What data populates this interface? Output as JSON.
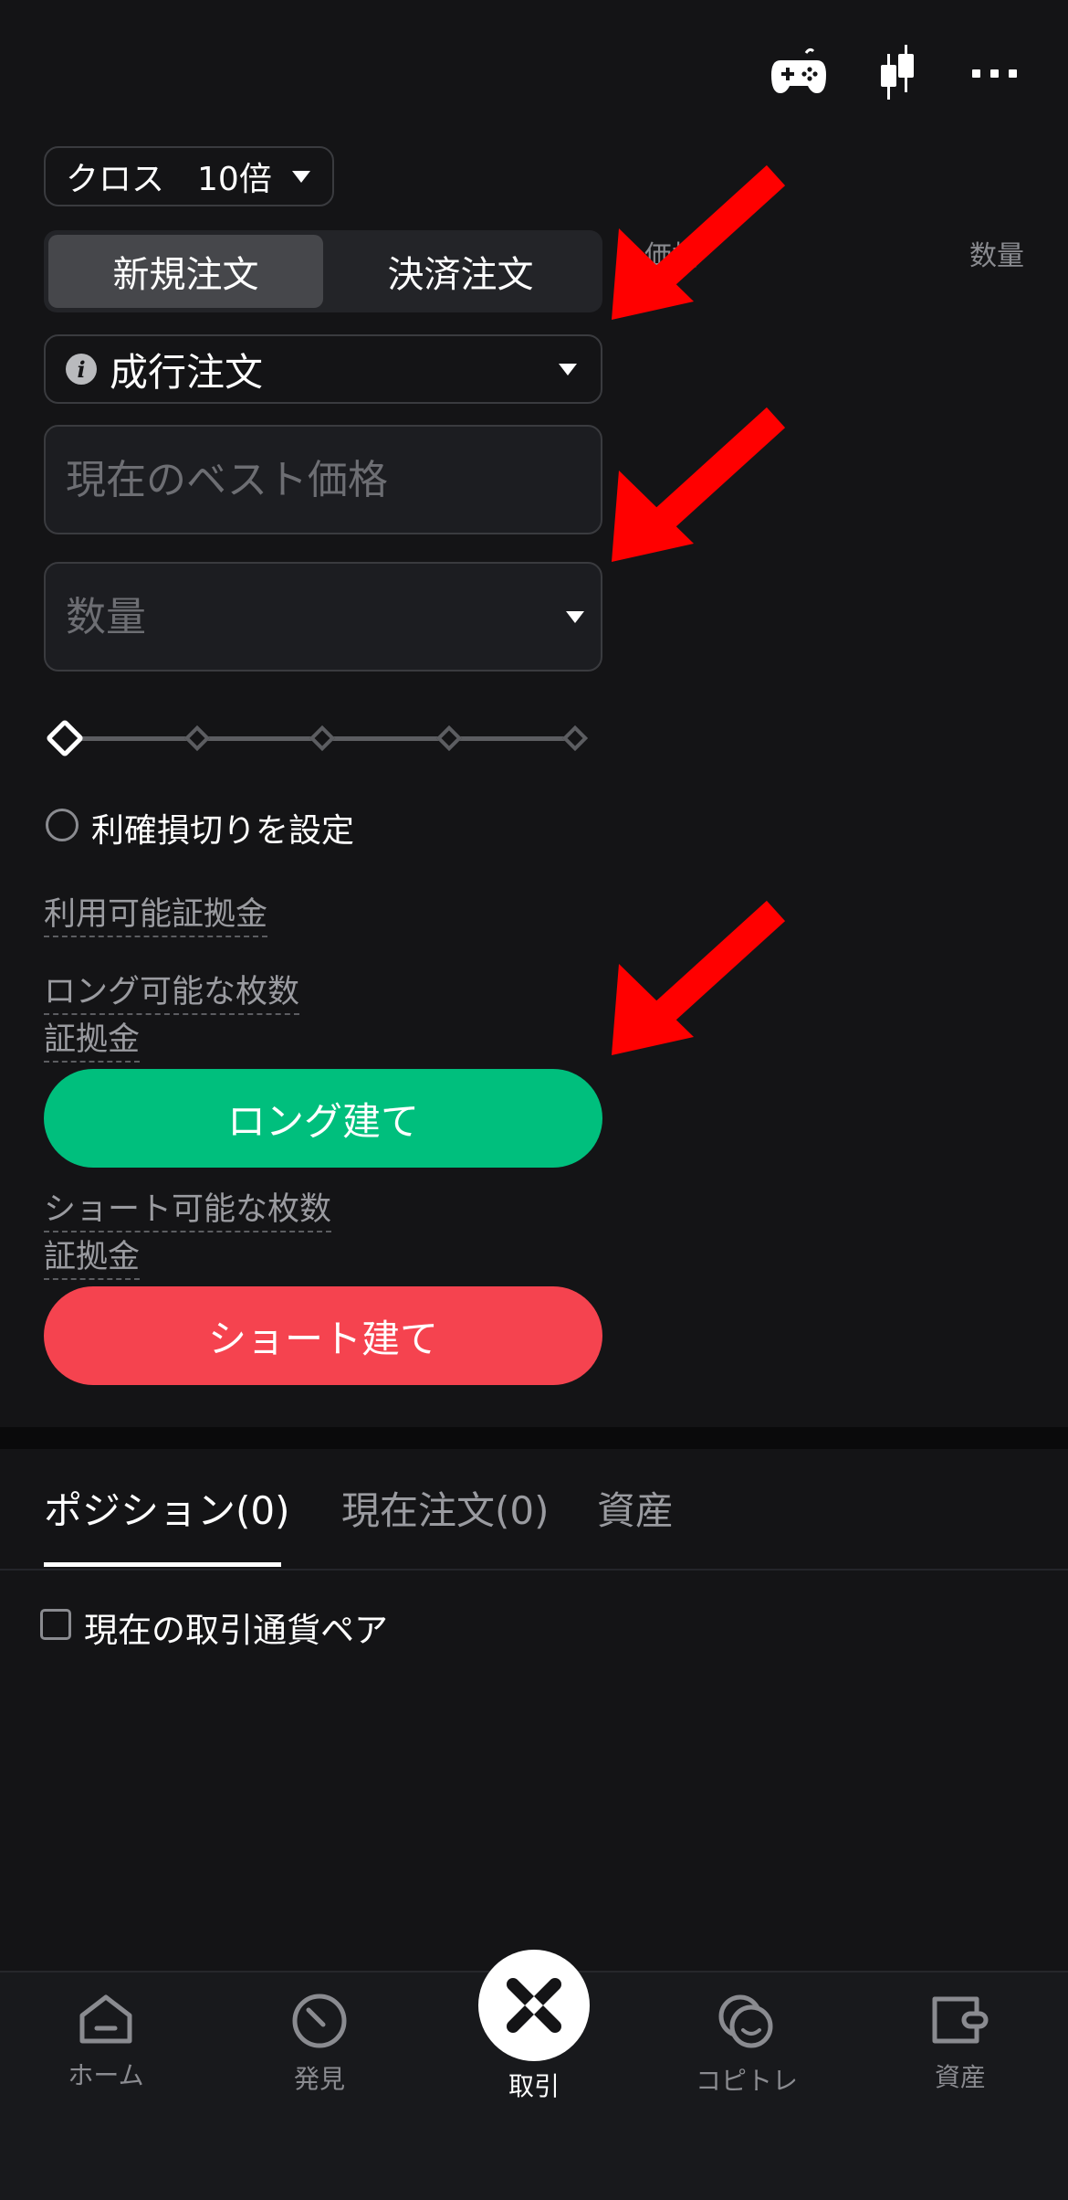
{
  "header": {
    "icons": [
      "gamepad-icon",
      "candlestick-icon",
      "more-icon"
    ]
  },
  "leverage": {
    "mode": "クロス",
    "value": "10倍"
  },
  "order_tabs": {
    "new": "新規注文",
    "close": "決済注文",
    "active": "new"
  },
  "orderbook": {
    "price_header": "価格",
    "qty_header": "数量"
  },
  "order_type": {
    "label": "成行注文"
  },
  "price_field": {
    "placeholder": "現在のベスト価格"
  },
  "qty_field": {
    "placeholder": "数量"
  },
  "tp_sl": {
    "label": "利確損切りを設定"
  },
  "info": {
    "available_margin": "利用可能証拠金",
    "long_qty": "ロング可能な枚数",
    "long_margin": "証拠金",
    "short_qty": "ショート可能な枚数",
    "short_margin": "証拠金"
  },
  "buttons": {
    "long": "ロング建て",
    "short": "ショート建て"
  },
  "colors": {
    "long": "#00bf7d",
    "short": "#f5434f",
    "background": "#141416",
    "arrow": "#ff0000"
  },
  "bottom_tabs": {
    "positions": "ポジション(0)",
    "open_orders": "現在注文(0)",
    "assets": "資産"
  },
  "filter": {
    "label": "現在の取引通貨ペア"
  },
  "nav": {
    "home": "ホーム",
    "discover": "発見",
    "trade": "取引",
    "copy": "コピトレ",
    "assets": "資産"
  }
}
